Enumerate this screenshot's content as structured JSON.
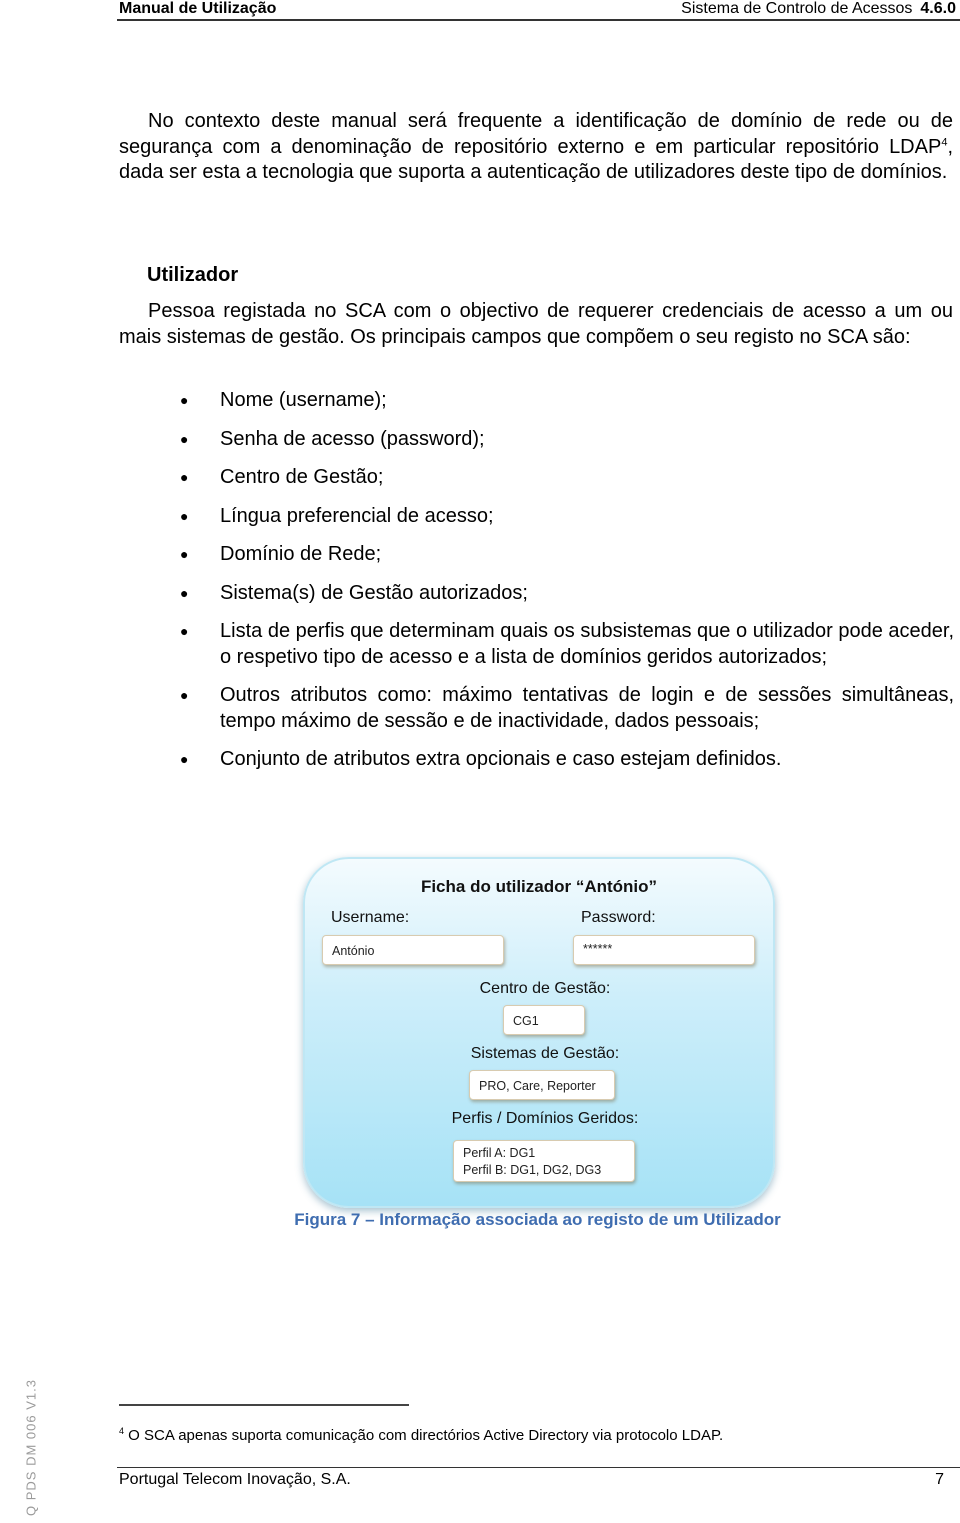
{
  "header": {
    "left": "Manual de Utilização",
    "right_title": "Sistema de Controlo de Acessos",
    "right_version": "4.6.0"
  },
  "intro_paragraph": {
    "text_before_sup": "No contexto deste manual será frequente a identificação de domínio de rede ou de segurança com a denominação de repositório externo e em particular repositório LDAP",
    "sup": "4",
    "text_after_sup": ", dada ser esta a tecnologia que suporta a autenticação de utilizadores deste tipo de domínios."
  },
  "section": {
    "title": "Utilizador",
    "paragraph": "Pessoa registada no SCA com o objectivo de requerer credenciais de acesso a um ou mais sistemas de gestão. Os principais campos que compõem o seu registo no SCA são:"
  },
  "bullets": [
    "Nome (username);",
    "Senha de acesso (password);",
    "Centro de Gestão;",
    "Língua preferencial de acesso;",
    "Domínio de Rede;",
    "Sistema(s) de Gestão autorizados;",
    "Lista de perfis que determinam quais os subsistemas que o utilizador pode aceder, o respetivo tipo de acesso e a lista de domínios geridos autorizados;",
    "Outros atributos como: máximo tentativas de login e de sessões simultâneas, tempo máximo de sessão e de inactividade, dados pessoais;",
    "Conjunto de atributos extra opcionais e caso estejam definidos."
  ],
  "figure": {
    "title": "Ficha do utilizador “António”",
    "username_label": "Username:",
    "username_value": "António",
    "password_label": "Password:",
    "password_value": "******",
    "centro_label": "Centro de Gestão:",
    "centro_value": "CG1",
    "sistemas_label": "Sistemas de Gestão:",
    "sistemas_value": "PRO, Care, Reporter",
    "perfis_label": "Perfis / Domínios Geridos:",
    "perfis_values": [
      "Perfil A: DG1",
      "Perfil B: DG1, DG2, DG3"
    ],
    "caption": "Figura 7 – Informação associada ao registo de um Utilizador"
  },
  "footnote": {
    "number": "4",
    "text": " O SCA apenas suporta comunicação com directórios Active Directory via protocolo LDAP."
  },
  "footer": {
    "company": "Portugal Telecom Inovação, S.A.",
    "page": "7",
    "side_code": "Q PDS DM 006 V1.3"
  },
  "colors": {
    "caption": "#3f6db0",
    "figure_bg": "#a6e2f6"
  }
}
